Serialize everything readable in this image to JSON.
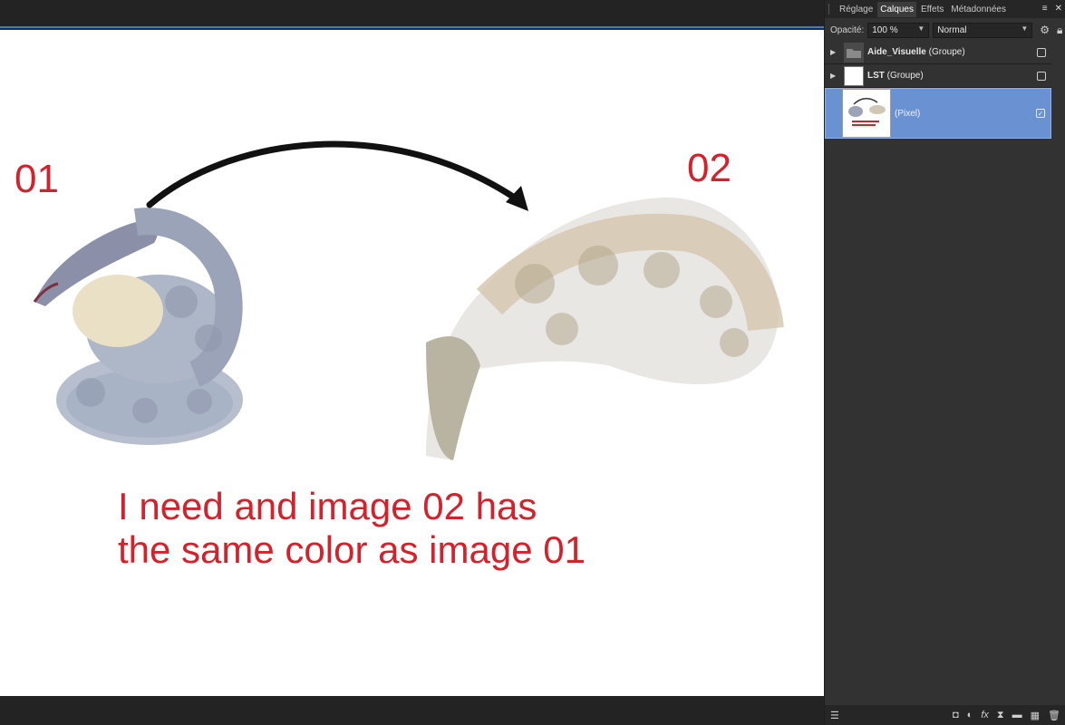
{
  "canvas": {
    "label_left": "01",
    "label_right": "02",
    "message_line1": "I need and image 02 has",
    "message_line2": "the same color as image 01"
  },
  "panel": {
    "tabs": [
      {
        "label": "Réglage",
        "active": false
      },
      {
        "label": "Calques",
        "active": true
      },
      {
        "label": "Effets",
        "active": false
      },
      {
        "label": "Métadonnées",
        "active": false
      }
    ],
    "opacity_label": "Opacité:",
    "opacity_value": "100 %",
    "blend_mode": "Normal",
    "layers": [
      {
        "name": "Aide_Visuelle",
        "type": "(Groupe)",
        "checked": false
      },
      {
        "name": "LST",
        "type": "(Groupe)",
        "checked": false
      },
      {
        "name": "",
        "type": "(Pixel)",
        "checked": true,
        "selected": true
      }
    ]
  },
  "colors": {
    "accent": "#3d7cc9",
    "selected_layer": "#6a91d1",
    "annotation_red": "#d4212b"
  }
}
